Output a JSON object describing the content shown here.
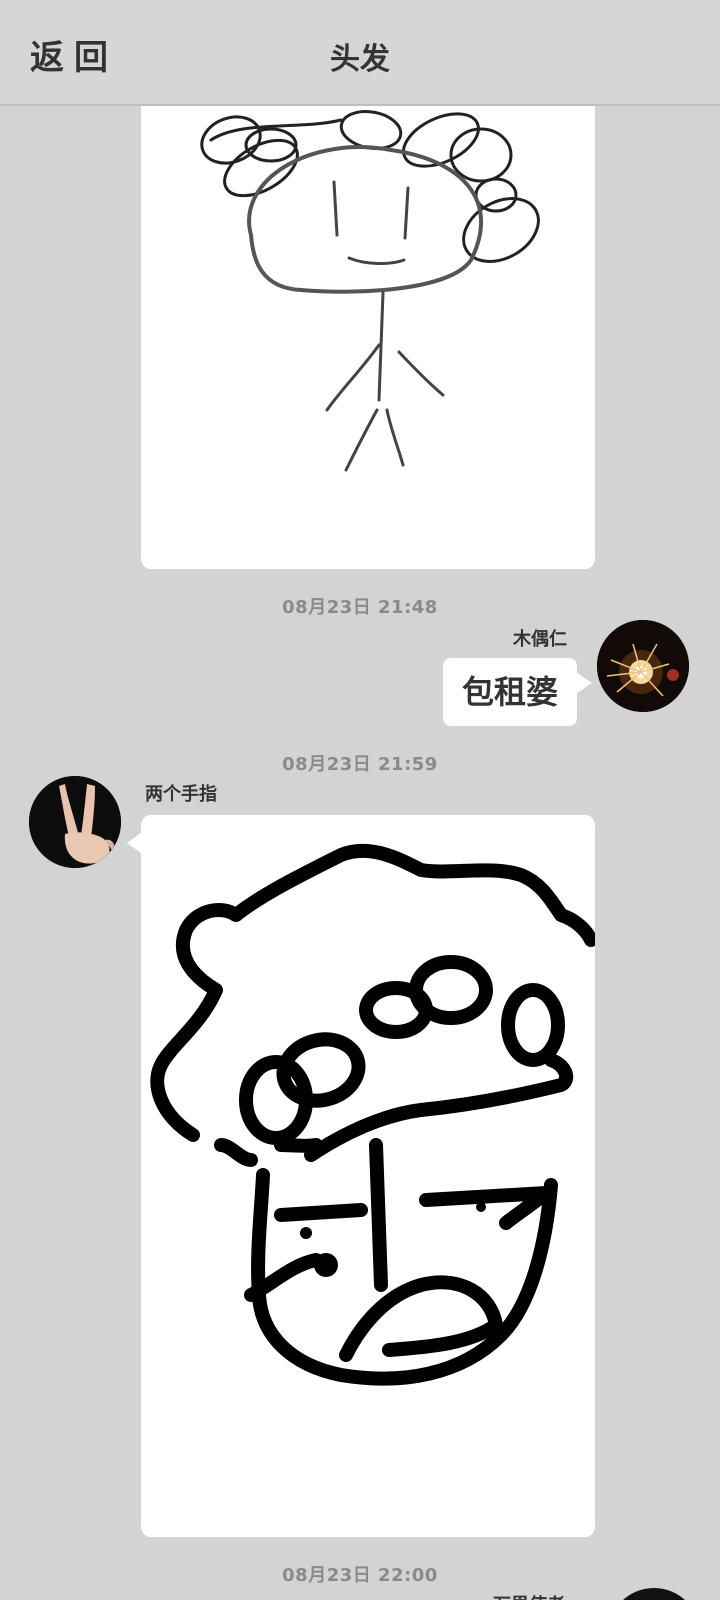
{
  "header": {
    "back_label": "返回",
    "title": "头发"
  },
  "messages": [
    {
      "time": "08月23日  21:48",
      "sender": "木偶仁",
      "text": "包租婆"
    },
    {
      "time": "08月23日  21:59",
      "sender": "两个手指"
    },
    {
      "time": "08月23日  22:00",
      "sender": "万界使者"
    }
  ],
  "colors": {
    "background": "#d3d3d3",
    "bubble": "#ffffff",
    "text": "#333333",
    "timestamp": "#8a8a8a"
  }
}
